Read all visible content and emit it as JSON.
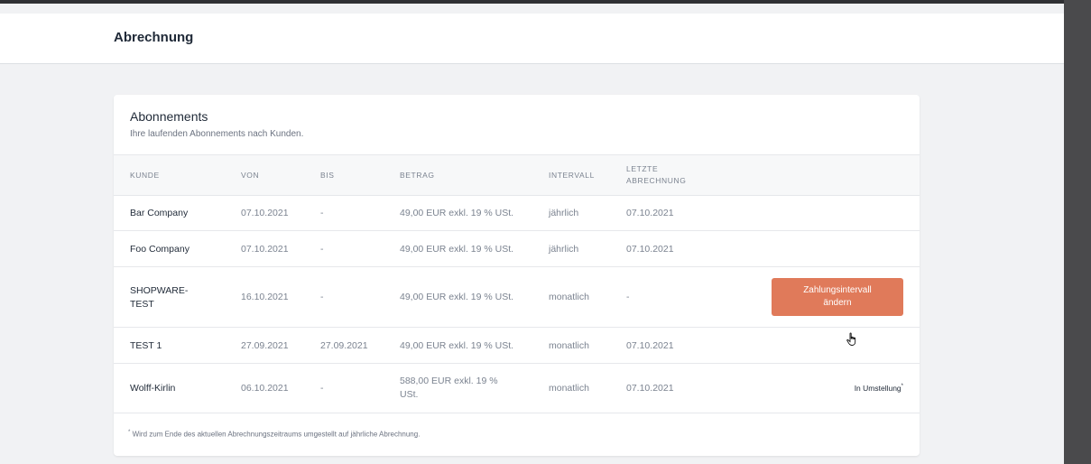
{
  "header": {
    "title": "Abrechnung"
  },
  "card": {
    "title": "Abonnements",
    "subtitle": "Ihre laufenden Abonnements nach Kunden."
  },
  "table": {
    "columns": {
      "kunde": "KUNDE",
      "von": "VON",
      "bis": "BIS",
      "betrag": "BETRAG",
      "intervall": "INTERVALL",
      "letzte1": "LETZTE",
      "letzte2": "ABRECHNUNG"
    },
    "rows": [
      {
        "kunde": "Bar Company",
        "von": "07.10.2021",
        "bis": "-",
        "betrag": "49,00 EUR exkl. 19 % USt.",
        "intervall": "jährlich",
        "letzte": "07.10.2021"
      },
      {
        "kunde": "Foo Company",
        "von": "07.10.2021",
        "bis": "-",
        "betrag": "49,00 EUR exkl. 19 % USt.",
        "intervall": "jährlich",
        "letzte": "07.10.2021"
      },
      {
        "kunde1": "SHOPWARE-",
        "kunde2": "TEST",
        "von": "16.10.2021",
        "bis": "-",
        "betrag": "49,00 EUR exkl. 19 % USt.",
        "intervall": "monatlich",
        "letzte": "-",
        "action1": "Zahlungsintervall",
        "action2": "ändern"
      },
      {
        "kunde": "TEST 1",
        "von": "27.09.2021",
        "bis": "27.09.2021",
        "betrag": "49,00 EUR exkl. 19 % USt.",
        "intervall": "monatlich",
        "letzte": "07.10.2021"
      },
      {
        "kunde": "Wolff-Kirlin",
        "von": "06.10.2021",
        "bis": "-",
        "betrag1": "588,00 EUR exkl. 19 %",
        "betrag2": "USt.",
        "intervall": "monatlich",
        "letzte": "07.10.2021",
        "status": "In Umstellung",
        "status_mark": "*"
      }
    ]
  },
  "footnote": {
    "mark": "*",
    "text": "Wird zum Ende des aktuellen Abrechnungszeitraums umgestellt auf jährliche Abrechnung."
  },
  "colors": {
    "accent": "#e07a5a",
    "background": "#f1f2f4"
  }
}
